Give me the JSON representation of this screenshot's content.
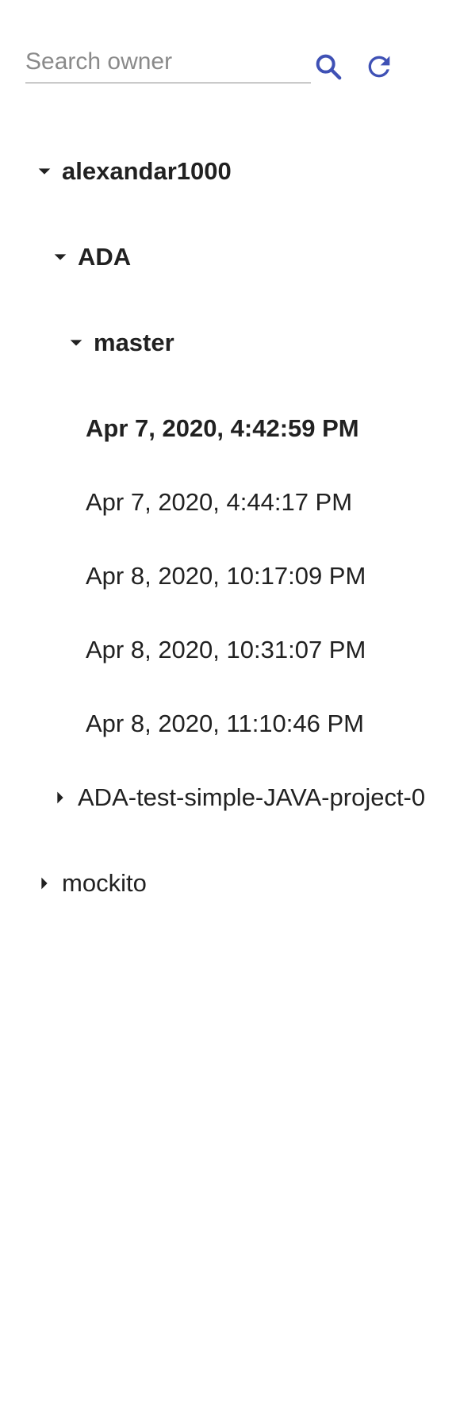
{
  "search": {
    "placeholder": "Search owner",
    "value": ""
  },
  "icons": {
    "search": "search-icon",
    "refresh": "refresh-icon",
    "accent_color": "#3f51b5"
  },
  "tree": {
    "owner": {
      "label": "alexandar1000",
      "expanded": true,
      "repos": [
        {
          "label": "ADA",
          "expanded": true,
          "branches": [
            {
              "label": "master",
              "expanded": true,
              "snapshots": [
                {
                  "label": "Apr 7, 2020, 4:42:59 PM",
                  "selected": true
                },
                {
                  "label": "Apr 7, 2020, 4:44:17 PM",
                  "selected": false
                },
                {
                  "label": "Apr 8, 2020, 10:17:09 PM",
                  "selected": false
                },
                {
                  "label": "Apr 8, 2020, 10:31:07 PM",
                  "selected": false
                },
                {
                  "label": "Apr 8, 2020, 11:10:46 PM",
                  "selected": false
                }
              ]
            }
          ]
        },
        {
          "label": "ADA-test-simple-JAVA-project-0",
          "expanded": false
        }
      ]
    },
    "other_owners": [
      {
        "label": "mockito",
        "expanded": false
      }
    ]
  }
}
